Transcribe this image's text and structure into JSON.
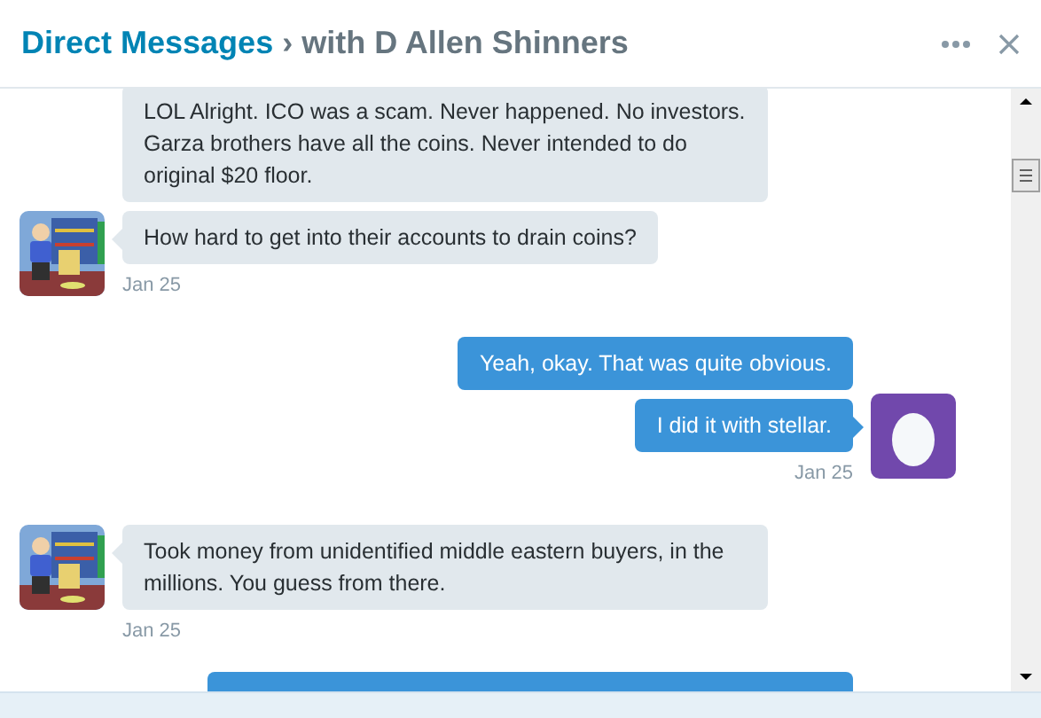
{
  "header": {
    "section": "Direct Messages",
    "separator": "›",
    "subtitle": "with D Allen Shinners"
  },
  "groups": [
    {
      "kind": "received",
      "messages": [
        "LOL  Alright. ICO was a scam. Never happened. No investors. Garza brothers have all the coins. Never intended to do original $20 floor.",
        "How hard to get into their accounts to drain coins?"
      ],
      "date": "Jan 25"
    },
    {
      "kind": "sent",
      "messages": [
        "Yeah, okay. That was quite obvious.",
        "I did it with stellar."
      ],
      "date": "Jan 25"
    },
    {
      "kind": "received",
      "messages": [
        "Took money from unidentified middle eastern buyers, in the millions. You guess from there."
      ],
      "date": "Jan 25"
    },
    {
      "kind": "sent",
      "partial": true
    }
  ]
}
